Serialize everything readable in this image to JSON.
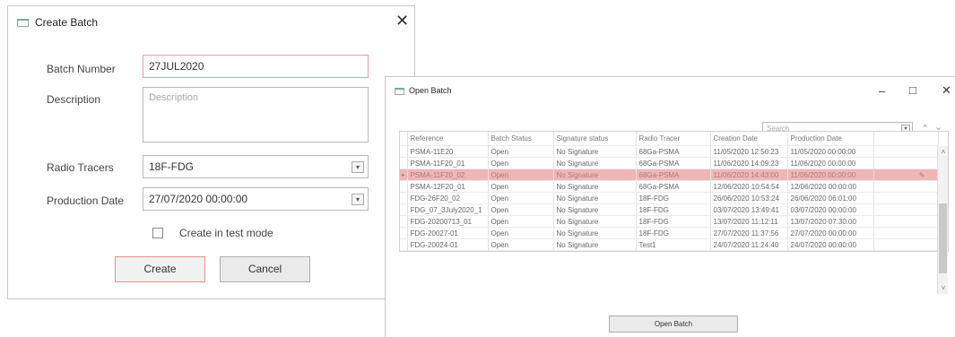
{
  "create_batch": {
    "title": "Create Batch",
    "close": "✕",
    "batch_number_label": "Batch Number",
    "batch_number_value": "27JUL2020",
    "description_label": "Description",
    "description_placeholder": "Description",
    "radio_tracers_label": "Radio Tracers",
    "radio_tracers_value": "18F-FDG",
    "production_date_label": "Production Date",
    "production_date_value": "27/07/2020 00:00:00",
    "test_mode_label": "Create in test mode",
    "create_label": "Create",
    "cancel_label": "Cancel",
    "dropdown_glyph": "▾"
  },
  "open_batch": {
    "title": "Open Batch",
    "minimize": "–",
    "maximize": "□",
    "close": "✕",
    "search_placeholder": "Search",
    "up_arrow": "⌃",
    "down_arrow": "⌄",
    "columns": [
      "Reference",
      "Batch Status",
      "Signature status",
      "Radio Tracer",
      "Creation Date",
      "Production Date"
    ],
    "rows": [
      [
        "PSMA-11E20",
        "Open",
        "No Signature",
        "68Ga-PSMA",
        "11/05/2020 12:50:23",
        "11/05/2020 00:00:00"
      ],
      [
        "PSMA-11F20_01",
        "Open",
        "No Signature",
        "68Ga-PSMA",
        "11/06/2020 14:09:23",
        "11/06/2020 00:00:00"
      ],
      [
        "PSMA-11F20_02",
        "Open",
        "No Signature",
        "68Ga-PSMA",
        "11/06/2020 14:43:00",
        "11/06/2020 00:00:00"
      ],
      [
        "PSMA-12F20_01",
        "Open",
        "No Signature",
        "68Ga-PSMA",
        "12/06/2020 10:54:54",
        "12/06/2020 00:00:00"
      ],
      [
        "FDG-26F20_02",
        "Open",
        "No Signature",
        "18F-FDG",
        "26/06/2020 10:53:24",
        "26/06/2020 06:01:00"
      ],
      [
        "FDG_07_3July2020_1",
        "Open",
        "No Signature",
        "18F-FDG",
        "03/07/2020 13:49:41",
        "03/07/2020 00:00:00"
      ],
      [
        "FDG-20200713_01",
        "Open",
        "No Signature",
        "18F-FDG",
        "13/07/2020 11:12:11",
        "13/07/2020 07:30:00"
      ],
      [
        "FDG-20027-01",
        "Open",
        "No Signature",
        "18F-FDG",
        "27/07/2020 11:37:56",
        "27/07/2020 00:00:00"
      ],
      [
        "FDG-20024-01",
        "Open",
        "No Signature",
        "Test1",
        "24/07/2020 11:24:40",
        "24/07/2020 00:00:00"
      ]
    ],
    "selected_row_index": 2,
    "row_indicator": "▸",
    "edit_glyph": "✎",
    "open_button_label": "Open Batch"
  }
}
